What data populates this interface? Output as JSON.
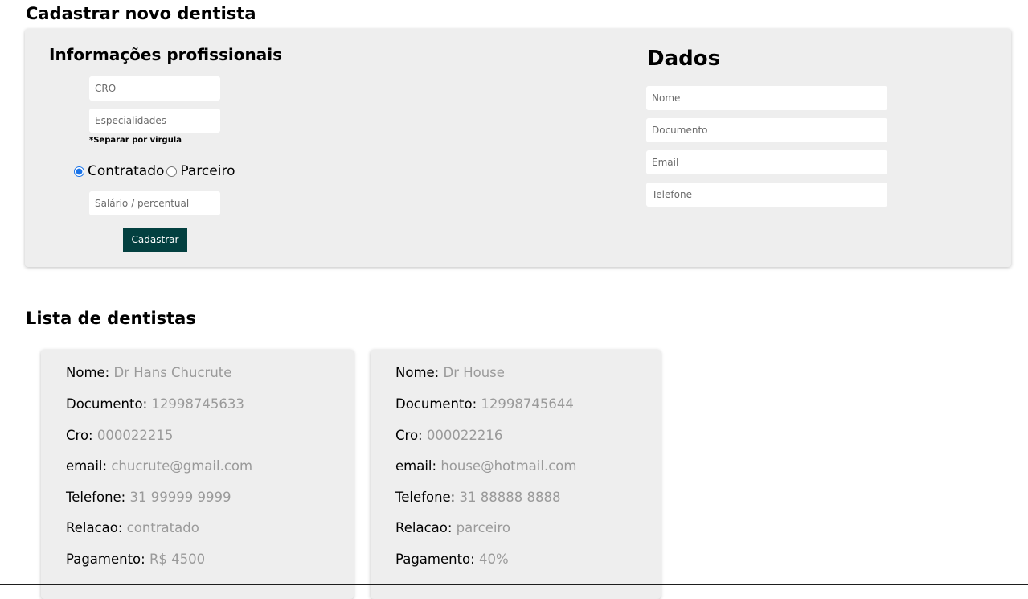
{
  "page": {
    "title": "Cadastrar novo dentista",
    "list_title": "Lista de dentistas"
  },
  "form": {
    "professional_title": "Informações profissionais",
    "data_title": "Dados",
    "cro_placeholder": "CRO",
    "specialties_placeholder": "Especialidades",
    "hint": "*Separar por virgula",
    "radio_contracted": "Contratado",
    "radio_partner": "Parceiro",
    "selected_relation": "Contratado",
    "payment_placeholder": "Salário / percentual",
    "submit_label": "Cadastrar",
    "name_placeholder": "Nome",
    "document_placeholder": "Documento",
    "email_placeholder": "Email",
    "phone_placeholder": "Telefone",
    "submit_color": "#034040"
  },
  "dentists": [
    {
      "nome_label": "Nome:",
      "nome": "Dr Hans Chucrute",
      "documento_label": "Documento:",
      "documento": "12998745633",
      "cro_label": "Cro:",
      "cro": "000022215",
      "email_label": "email:",
      "email": "chucrute@gmail.com",
      "telefone_label": "Telefone:",
      "telefone": "31 99999 9999",
      "relacao_label": "Relacao:",
      "relacao": "contratado",
      "pagamento_label": "Pagamento:",
      "pagamento": "R$ 4500"
    },
    {
      "nome_label": "Nome:",
      "nome": "Dr House",
      "documento_label": "Documento:",
      "documento": "12998745644",
      "cro_label": "Cro:",
      "cro": "000022216",
      "email_label": "email:",
      "email": "house@hotmail.com",
      "telefone_label": "Telefone:",
      "telefone": "31 88888 8888",
      "relacao_label": "Relacao:",
      "relacao": "parceiro",
      "pagamento_label": "Pagamento:",
      "pagamento": "40%"
    }
  ]
}
